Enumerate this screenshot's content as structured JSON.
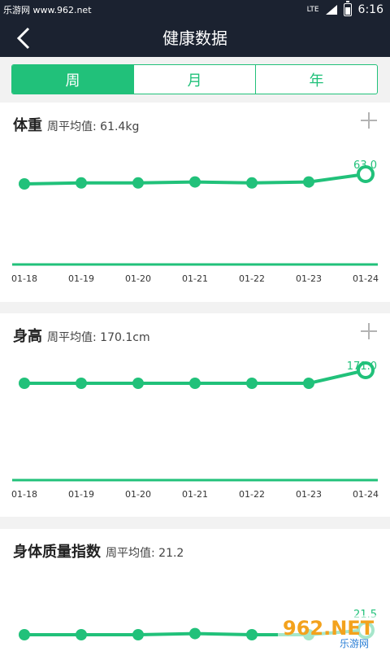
{
  "status_bar": {
    "watermark": "乐游网 www.962.net",
    "network": "LTE",
    "time": "6:16"
  },
  "header": {
    "title": "健康数据"
  },
  "tabs": [
    {
      "label": "周",
      "active": true
    },
    {
      "label": "月",
      "active": false
    },
    {
      "label": "年",
      "active": false
    }
  ],
  "cards": [
    {
      "title": "体重",
      "avg_label": "周平均值: 61.4kg",
      "last_value": "63.0"
    },
    {
      "title": "身高",
      "avg_label": "周平均值: 170.1cm",
      "last_value": "171.0"
    },
    {
      "title": "身体质量指数",
      "avg_label": "周平均值: 21.2",
      "last_value": "21.5"
    }
  ],
  "chart_data": [
    {
      "type": "line",
      "title": "体重",
      "categories": [
        "01-18",
        "01-19",
        "01-20",
        "01-21",
        "01-22",
        "01-23",
        "01-24"
      ],
      "values": [
        61.0,
        61.2,
        61.2,
        61.4,
        61.2,
        61.4,
        63.0
      ]
    },
    {
      "type": "line",
      "title": "身高",
      "categories": [
        "01-18",
        "01-19",
        "01-20",
        "01-21",
        "01-22",
        "01-23",
        "01-24"
      ],
      "values": [
        170.0,
        170.0,
        170.0,
        170.0,
        170.0,
        170.0,
        171.0
      ]
    },
    {
      "type": "line",
      "title": "身体质量指数",
      "categories": [],
      "values": [
        21.1,
        21.1,
        21.1,
        21.2,
        21.1,
        21.1,
        21.5
      ]
    }
  ],
  "colors": {
    "accent": "#21c17a",
    "appbar": "#1b2230",
    "background": "#f2f2f2"
  },
  "watermark_bottom": {
    "text": "962.NET",
    "subtext": "乐游网"
  }
}
